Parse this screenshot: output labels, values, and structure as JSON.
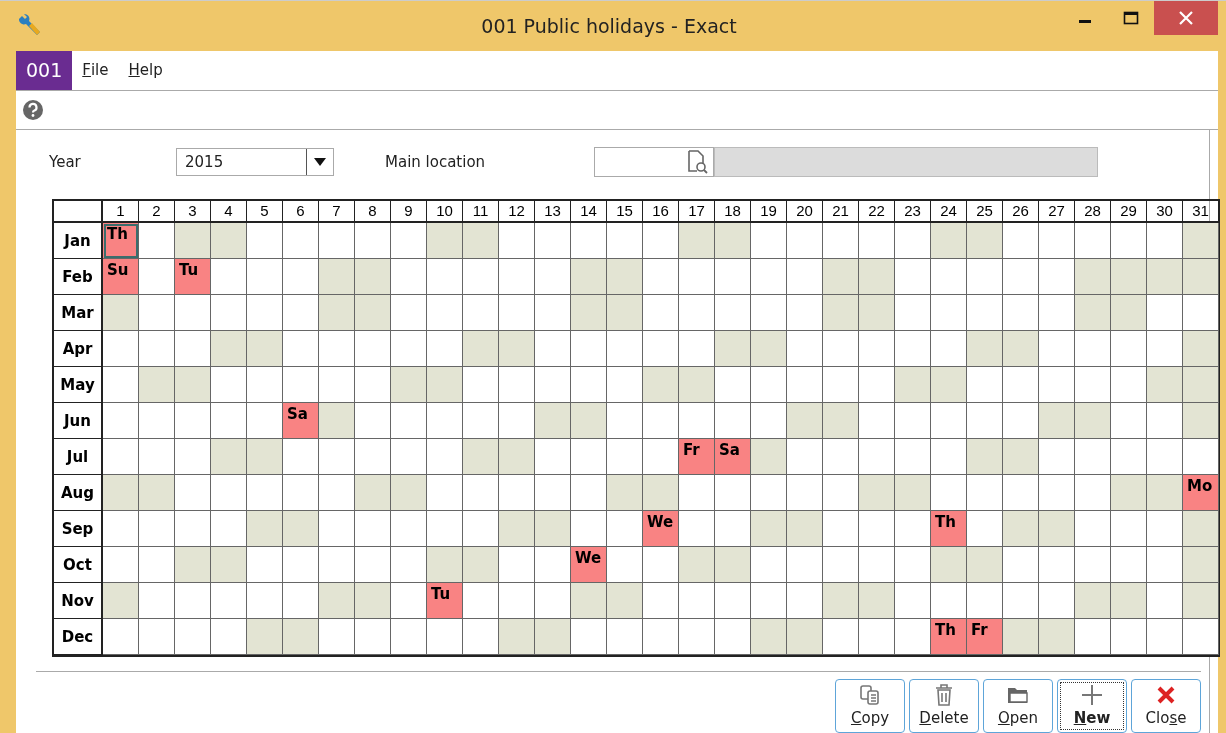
{
  "window": {
    "title": "001 Public holidays - Exact"
  },
  "menu": {
    "badge": "001",
    "items": [
      {
        "key": "F",
        "after": "ile"
      },
      {
        "key": "H",
        "after": "elp"
      }
    ]
  },
  "form": {
    "year_label": "Year",
    "year_value": "2015",
    "location_label": "Main location"
  },
  "calendar": {
    "days": [
      "1",
      "2",
      "3",
      "4",
      "5",
      "6",
      "7",
      "8",
      "9",
      "10",
      "11",
      "12",
      "13",
      "14",
      "15",
      "16",
      "17",
      "18",
      "19",
      "20",
      "21",
      "22",
      "23",
      "24",
      "25",
      "26",
      "27",
      "28",
      "29",
      "30",
      "31"
    ],
    "months": [
      {
        "name": "Jan",
        "days": [
          {
            "kind": "holiday",
            "label": "Th",
            "focused": true
          },
          {
            "kind": "plain"
          },
          {
            "kind": "shaded"
          },
          {
            "kind": "shaded"
          },
          {
            "kind": "plain"
          },
          {
            "kind": "plain"
          },
          {
            "kind": "plain"
          },
          {
            "kind": "plain"
          },
          {
            "kind": "plain"
          },
          {
            "kind": "shaded"
          },
          {
            "kind": "shaded"
          },
          {
            "kind": "plain"
          },
          {
            "kind": "plain"
          },
          {
            "kind": "plain"
          },
          {
            "kind": "plain"
          },
          {
            "kind": "plain"
          },
          {
            "kind": "shaded"
          },
          {
            "kind": "shaded"
          },
          {
            "kind": "plain"
          },
          {
            "kind": "plain"
          },
          {
            "kind": "plain"
          },
          {
            "kind": "plain"
          },
          {
            "kind": "plain"
          },
          {
            "kind": "shaded"
          },
          {
            "kind": "shaded"
          },
          {
            "kind": "plain"
          },
          {
            "kind": "plain"
          },
          {
            "kind": "plain"
          },
          {
            "kind": "plain"
          },
          {
            "kind": "plain"
          },
          {
            "kind": "shaded"
          }
        ]
      },
      {
        "name": "Feb",
        "days": [
          {
            "kind": "holiday",
            "label": "Su"
          },
          {
            "kind": "plain"
          },
          {
            "kind": "holiday",
            "label": "Tu"
          },
          {
            "kind": "plain"
          },
          {
            "kind": "plain"
          },
          {
            "kind": "plain"
          },
          {
            "kind": "shaded"
          },
          {
            "kind": "shaded"
          },
          {
            "kind": "plain"
          },
          {
            "kind": "plain"
          },
          {
            "kind": "plain"
          },
          {
            "kind": "plain"
          },
          {
            "kind": "plain"
          },
          {
            "kind": "shaded"
          },
          {
            "kind": "shaded"
          },
          {
            "kind": "plain"
          },
          {
            "kind": "plain"
          },
          {
            "kind": "plain"
          },
          {
            "kind": "plain"
          },
          {
            "kind": "plain"
          },
          {
            "kind": "shaded"
          },
          {
            "kind": "shaded"
          },
          {
            "kind": "plain"
          },
          {
            "kind": "plain"
          },
          {
            "kind": "plain"
          },
          {
            "kind": "plain"
          },
          {
            "kind": "plain"
          },
          {
            "kind": "shaded"
          },
          {
            "kind": "shaded"
          },
          {
            "kind": "shaded"
          },
          {
            "kind": "shaded"
          }
        ]
      },
      {
        "name": "Mar",
        "days": [
          {
            "kind": "shaded"
          },
          {
            "kind": "plain"
          },
          {
            "kind": "plain"
          },
          {
            "kind": "plain"
          },
          {
            "kind": "plain"
          },
          {
            "kind": "plain"
          },
          {
            "kind": "shaded"
          },
          {
            "kind": "shaded"
          },
          {
            "kind": "plain"
          },
          {
            "kind": "plain"
          },
          {
            "kind": "plain"
          },
          {
            "kind": "plain"
          },
          {
            "kind": "plain"
          },
          {
            "kind": "shaded"
          },
          {
            "kind": "shaded"
          },
          {
            "kind": "plain"
          },
          {
            "kind": "plain"
          },
          {
            "kind": "plain"
          },
          {
            "kind": "plain"
          },
          {
            "kind": "plain"
          },
          {
            "kind": "shaded"
          },
          {
            "kind": "shaded"
          },
          {
            "kind": "plain"
          },
          {
            "kind": "plain"
          },
          {
            "kind": "plain"
          },
          {
            "kind": "plain"
          },
          {
            "kind": "plain"
          },
          {
            "kind": "shaded"
          },
          {
            "kind": "shaded"
          },
          {
            "kind": "plain"
          },
          {
            "kind": "plain"
          }
        ]
      },
      {
        "name": "Apr",
        "days": [
          {
            "kind": "plain"
          },
          {
            "kind": "plain"
          },
          {
            "kind": "plain"
          },
          {
            "kind": "shaded"
          },
          {
            "kind": "shaded"
          },
          {
            "kind": "plain"
          },
          {
            "kind": "plain"
          },
          {
            "kind": "plain"
          },
          {
            "kind": "plain"
          },
          {
            "kind": "plain"
          },
          {
            "kind": "shaded"
          },
          {
            "kind": "shaded"
          },
          {
            "kind": "plain"
          },
          {
            "kind": "plain"
          },
          {
            "kind": "plain"
          },
          {
            "kind": "plain"
          },
          {
            "kind": "plain"
          },
          {
            "kind": "shaded"
          },
          {
            "kind": "shaded"
          },
          {
            "kind": "plain"
          },
          {
            "kind": "plain"
          },
          {
            "kind": "plain"
          },
          {
            "kind": "plain"
          },
          {
            "kind": "plain"
          },
          {
            "kind": "shaded"
          },
          {
            "kind": "shaded"
          },
          {
            "kind": "plain"
          },
          {
            "kind": "plain"
          },
          {
            "kind": "plain"
          },
          {
            "kind": "plain"
          },
          {
            "kind": "shaded"
          }
        ]
      },
      {
        "name": "May",
        "days": [
          {
            "kind": "plain"
          },
          {
            "kind": "shaded"
          },
          {
            "kind": "shaded"
          },
          {
            "kind": "plain"
          },
          {
            "kind": "plain"
          },
          {
            "kind": "plain"
          },
          {
            "kind": "plain"
          },
          {
            "kind": "plain"
          },
          {
            "kind": "shaded"
          },
          {
            "kind": "shaded"
          },
          {
            "kind": "plain"
          },
          {
            "kind": "plain"
          },
          {
            "kind": "plain"
          },
          {
            "kind": "plain"
          },
          {
            "kind": "plain"
          },
          {
            "kind": "shaded"
          },
          {
            "kind": "shaded"
          },
          {
            "kind": "plain"
          },
          {
            "kind": "plain"
          },
          {
            "kind": "plain"
          },
          {
            "kind": "plain"
          },
          {
            "kind": "plain"
          },
          {
            "kind": "shaded"
          },
          {
            "kind": "shaded"
          },
          {
            "kind": "plain"
          },
          {
            "kind": "plain"
          },
          {
            "kind": "plain"
          },
          {
            "kind": "plain"
          },
          {
            "kind": "plain"
          },
          {
            "kind": "shaded"
          },
          {
            "kind": "shaded"
          }
        ]
      },
      {
        "name": "Jun",
        "days": [
          {
            "kind": "plain"
          },
          {
            "kind": "plain"
          },
          {
            "kind": "plain"
          },
          {
            "kind": "plain"
          },
          {
            "kind": "plain"
          },
          {
            "kind": "holiday",
            "label": "Sa"
          },
          {
            "kind": "shaded"
          },
          {
            "kind": "plain"
          },
          {
            "kind": "plain"
          },
          {
            "kind": "plain"
          },
          {
            "kind": "plain"
          },
          {
            "kind": "plain"
          },
          {
            "kind": "shaded"
          },
          {
            "kind": "shaded"
          },
          {
            "kind": "plain"
          },
          {
            "kind": "plain"
          },
          {
            "kind": "plain"
          },
          {
            "kind": "plain"
          },
          {
            "kind": "plain"
          },
          {
            "kind": "shaded"
          },
          {
            "kind": "shaded"
          },
          {
            "kind": "plain"
          },
          {
            "kind": "plain"
          },
          {
            "kind": "plain"
          },
          {
            "kind": "plain"
          },
          {
            "kind": "plain"
          },
          {
            "kind": "shaded"
          },
          {
            "kind": "shaded"
          },
          {
            "kind": "plain"
          },
          {
            "kind": "plain"
          },
          {
            "kind": "shaded"
          }
        ]
      },
      {
        "name": "Jul",
        "days": [
          {
            "kind": "plain"
          },
          {
            "kind": "plain"
          },
          {
            "kind": "plain"
          },
          {
            "kind": "shaded"
          },
          {
            "kind": "shaded"
          },
          {
            "kind": "plain"
          },
          {
            "kind": "plain"
          },
          {
            "kind": "plain"
          },
          {
            "kind": "plain"
          },
          {
            "kind": "plain"
          },
          {
            "kind": "shaded"
          },
          {
            "kind": "shaded"
          },
          {
            "kind": "plain"
          },
          {
            "kind": "plain"
          },
          {
            "kind": "plain"
          },
          {
            "kind": "plain"
          },
          {
            "kind": "holiday",
            "label": "Fr"
          },
          {
            "kind": "holiday",
            "label": "Sa"
          },
          {
            "kind": "shaded"
          },
          {
            "kind": "plain"
          },
          {
            "kind": "plain"
          },
          {
            "kind": "plain"
          },
          {
            "kind": "plain"
          },
          {
            "kind": "plain"
          },
          {
            "kind": "shaded"
          },
          {
            "kind": "shaded"
          },
          {
            "kind": "plain"
          },
          {
            "kind": "plain"
          },
          {
            "kind": "plain"
          },
          {
            "kind": "plain"
          },
          {
            "kind": "plain"
          }
        ]
      },
      {
        "name": "Aug",
        "days": [
          {
            "kind": "shaded"
          },
          {
            "kind": "shaded"
          },
          {
            "kind": "plain"
          },
          {
            "kind": "plain"
          },
          {
            "kind": "plain"
          },
          {
            "kind": "plain"
          },
          {
            "kind": "plain"
          },
          {
            "kind": "shaded"
          },
          {
            "kind": "shaded"
          },
          {
            "kind": "plain"
          },
          {
            "kind": "plain"
          },
          {
            "kind": "plain"
          },
          {
            "kind": "plain"
          },
          {
            "kind": "plain"
          },
          {
            "kind": "shaded"
          },
          {
            "kind": "shaded"
          },
          {
            "kind": "plain"
          },
          {
            "kind": "plain"
          },
          {
            "kind": "plain"
          },
          {
            "kind": "plain"
          },
          {
            "kind": "plain"
          },
          {
            "kind": "shaded"
          },
          {
            "kind": "shaded"
          },
          {
            "kind": "plain"
          },
          {
            "kind": "plain"
          },
          {
            "kind": "plain"
          },
          {
            "kind": "plain"
          },
          {
            "kind": "plain"
          },
          {
            "kind": "shaded"
          },
          {
            "kind": "shaded"
          },
          {
            "kind": "holiday",
            "label": "Mo"
          }
        ]
      },
      {
        "name": "Sep",
        "days": [
          {
            "kind": "plain"
          },
          {
            "kind": "plain"
          },
          {
            "kind": "plain"
          },
          {
            "kind": "plain"
          },
          {
            "kind": "shaded"
          },
          {
            "kind": "shaded"
          },
          {
            "kind": "plain"
          },
          {
            "kind": "plain"
          },
          {
            "kind": "plain"
          },
          {
            "kind": "plain"
          },
          {
            "kind": "plain"
          },
          {
            "kind": "shaded"
          },
          {
            "kind": "shaded"
          },
          {
            "kind": "plain"
          },
          {
            "kind": "plain"
          },
          {
            "kind": "holiday",
            "label": "We"
          },
          {
            "kind": "plain"
          },
          {
            "kind": "plain"
          },
          {
            "kind": "shaded"
          },
          {
            "kind": "shaded"
          },
          {
            "kind": "plain"
          },
          {
            "kind": "plain"
          },
          {
            "kind": "plain"
          },
          {
            "kind": "holiday",
            "label": "Th"
          },
          {
            "kind": "plain"
          },
          {
            "kind": "shaded"
          },
          {
            "kind": "shaded"
          },
          {
            "kind": "plain"
          },
          {
            "kind": "plain"
          },
          {
            "kind": "plain"
          },
          {
            "kind": "shaded"
          }
        ]
      },
      {
        "name": "Oct",
        "days": [
          {
            "kind": "plain"
          },
          {
            "kind": "plain"
          },
          {
            "kind": "shaded"
          },
          {
            "kind": "shaded"
          },
          {
            "kind": "plain"
          },
          {
            "kind": "plain"
          },
          {
            "kind": "plain"
          },
          {
            "kind": "plain"
          },
          {
            "kind": "plain"
          },
          {
            "kind": "shaded"
          },
          {
            "kind": "shaded"
          },
          {
            "kind": "plain"
          },
          {
            "kind": "plain"
          },
          {
            "kind": "holiday",
            "label": "We"
          },
          {
            "kind": "plain"
          },
          {
            "kind": "plain"
          },
          {
            "kind": "shaded"
          },
          {
            "kind": "shaded"
          },
          {
            "kind": "plain"
          },
          {
            "kind": "plain"
          },
          {
            "kind": "plain"
          },
          {
            "kind": "plain"
          },
          {
            "kind": "plain"
          },
          {
            "kind": "shaded"
          },
          {
            "kind": "shaded"
          },
          {
            "kind": "plain"
          },
          {
            "kind": "plain"
          },
          {
            "kind": "plain"
          },
          {
            "kind": "plain"
          },
          {
            "kind": "plain"
          },
          {
            "kind": "shaded"
          }
        ]
      },
      {
        "name": "Nov",
        "days": [
          {
            "kind": "shaded"
          },
          {
            "kind": "plain"
          },
          {
            "kind": "plain"
          },
          {
            "kind": "plain"
          },
          {
            "kind": "plain"
          },
          {
            "kind": "plain"
          },
          {
            "kind": "shaded"
          },
          {
            "kind": "shaded"
          },
          {
            "kind": "plain"
          },
          {
            "kind": "holiday",
            "label": "Tu"
          },
          {
            "kind": "plain"
          },
          {
            "kind": "plain"
          },
          {
            "kind": "plain"
          },
          {
            "kind": "shaded"
          },
          {
            "kind": "shaded"
          },
          {
            "kind": "plain"
          },
          {
            "kind": "plain"
          },
          {
            "kind": "plain"
          },
          {
            "kind": "plain"
          },
          {
            "kind": "plain"
          },
          {
            "kind": "shaded"
          },
          {
            "kind": "shaded"
          },
          {
            "kind": "plain"
          },
          {
            "kind": "plain"
          },
          {
            "kind": "plain"
          },
          {
            "kind": "plain"
          },
          {
            "kind": "plain"
          },
          {
            "kind": "shaded"
          },
          {
            "kind": "shaded"
          },
          {
            "kind": "plain"
          },
          {
            "kind": "shaded"
          }
        ]
      },
      {
        "name": "Dec",
        "days": [
          {
            "kind": "plain"
          },
          {
            "kind": "plain"
          },
          {
            "kind": "plain"
          },
          {
            "kind": "plain"
          },
          {
            "kind": "shaded"
          },
          {
            "kind": "shaded"
          },
          {
            "kind": "plain"
          },
          {
            "kind": "plain"
          },
          {
            "kind": "plain"
          },
          {
            "kind": "plain"
          },
          {
            "kind": "plain"
          },
          {
            "kind": "shaded"
          },
          {
            "kind": "shaded"
          },
          {
            "kind": "plain"
          },
          {
            "kind": "plain"
          },
          {
            "kind": "plain"
          },
          {
            "kind": "plain"
          },
          {
            "kind": "plain"
          },
          {
            "kind": "shaded"
          },
          {
            "kind": "shaded"
          },
          {
            "kind": "plain"
          },
          {
            "kind": "plain"
          },
          {
            "kind": "plain"
          },
          {
            "kind": "holiday",
            "label": "Th"
          },
          {
            "kind": "holiday",
            "label": "Fr"
          },
          {
            "kind": "shaded"
          },
          {
            "kind": "shaded"
          },
          {
            "kind": "plain"
          },
          {
            "kind": "plain"
          },
          {
            "kind": "plain"
          },
          {
            "kind": "plain"
          }
        ]
      }
    ]
  },
  "buttons": [
    {
      "kind": "copy",
      "key": "C",
      "after": "opy",
      "default": false
    },
    {
      "kind": "delete",
      "key": "D",
      "after": "elete",
      "default": false
    },
    {
      "kind": "open",
      "key": "O",
      "after": "pen",
      "default": false
    },
    {
      "kind": "new",
      "key": "N",
      "after": "ew",
      "default": true
    },
    {
      "kind": "close",
      "before": "Clo",
      "key": "s",
      "after": "e",
      "default": false
    }
  ]
}
